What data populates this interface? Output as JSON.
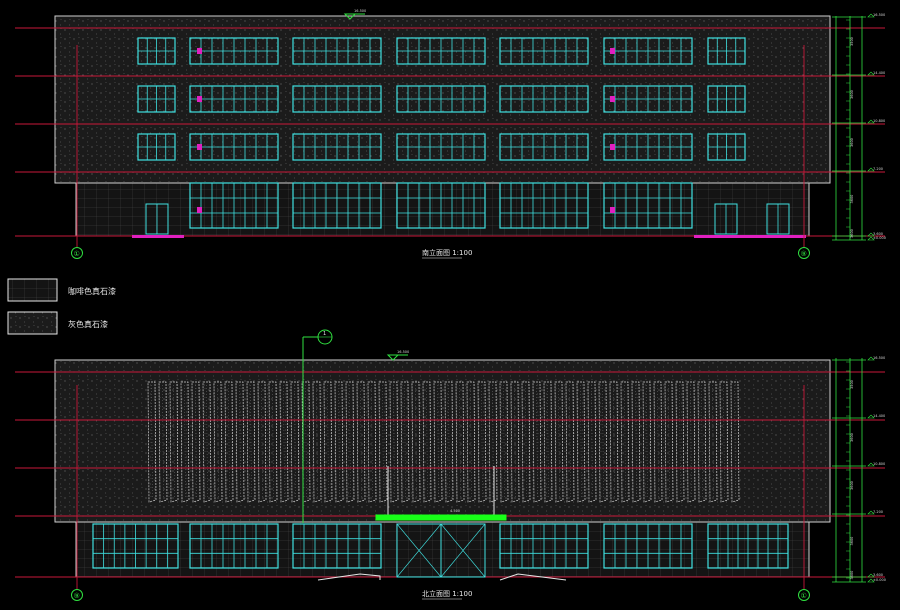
{
  "drawing": {
    "background": "#000000",
    "colors": {
      "level_line": "#c8183a",
      "window": "#3fe0e0",
      "wall_fill": "#1b1b1b",
      "wall_dots": "#6a6a6a",
      "wall_grid": "#474747",
      "white_line": "#e6e6e6",
      "magenta": "#e020c0",
      "green": "#30e040",
      "bright_green": "#18ff18",
      "dim_text": "#d8d8d8"
    }
  },
  "south_elevation": {
    "title": "南立面图 1:100",
    "axis_left": "①",
    "axis_right": "⑨",
    "top_mark": "16.500",
    "dims": [
      "3500",
      "3600",
      "3600",
      "3600",
      "3600",
      "1800"
    ],
    "levels": [
      "16.500",
      "14.400",
      "10.800",
      "7.200",
      "3.600",
      "±0.000",
      "-0.450"
    ]
  },
  "north_elevation": {
    "title": "北立面图 1:100",
    "axis_left": "⑨",
    "axis_right": "①",
    "top_mark": "16.500",
    "section_marker": "1",
    "canopy_mark": "4.500",
    "dims": [
      "3500",
      "3600",
      "3600",
      "3600",
      "3600",
      "1800"
    ],
    "levels": [
      "16.500",
      "14.400",
      "10.800",
      "7.200",
      "3.600",
      "±0.000",
      "-0.450"
    ]
  },
  "legend": [
    {
      "label": "咖啡色真石漆",
      "pattern": "grid"
    },
    {
      "label": "灰色真石漆",
      "pattern": "dots"
    }
  ]
}
